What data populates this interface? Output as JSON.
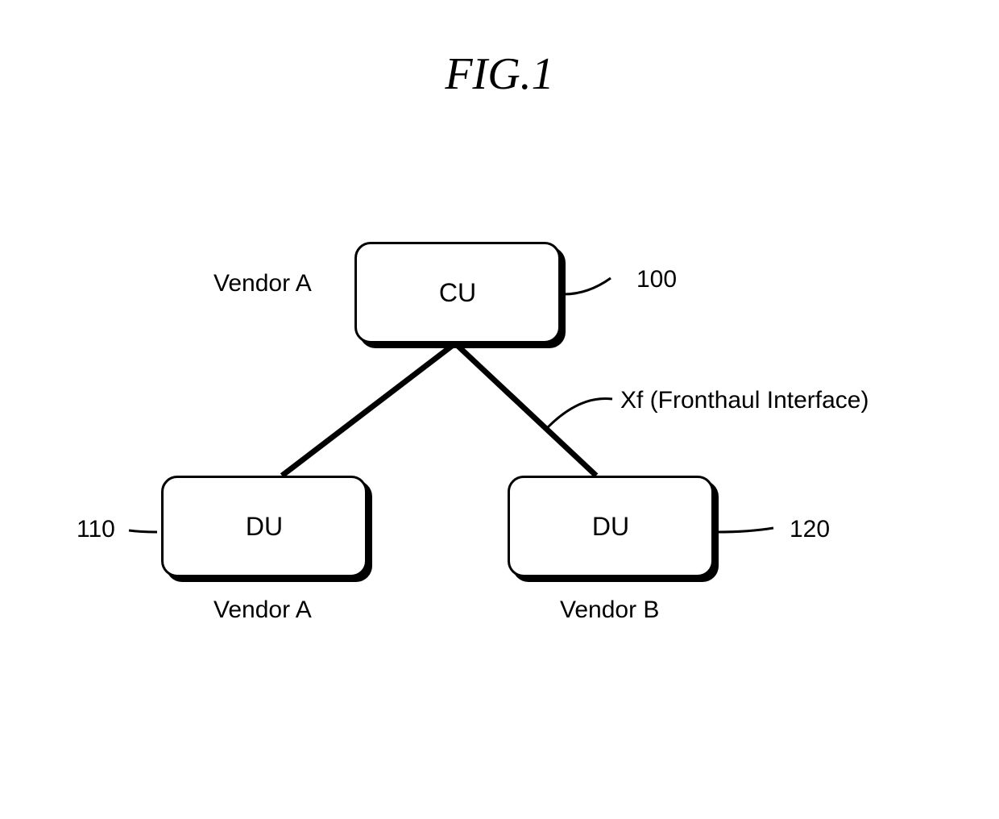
{
  "title": "FIG.1",
  "nodes": {
    "cu": {
      "label": "CU",
      "vendor": "Vendor A",
      "ref": "100"
    },
    "du1": {
      "label": "DU",
      "vendor": "Vendor A",
      "ref": "110"
    },
    "du2": {
      "label": "DU",
      "vendor": "Vendor B",
      "ref": "120"
    }
  },
  "interface": {
    "label": "Xf (Fronthaul Interface)"
  }
}
